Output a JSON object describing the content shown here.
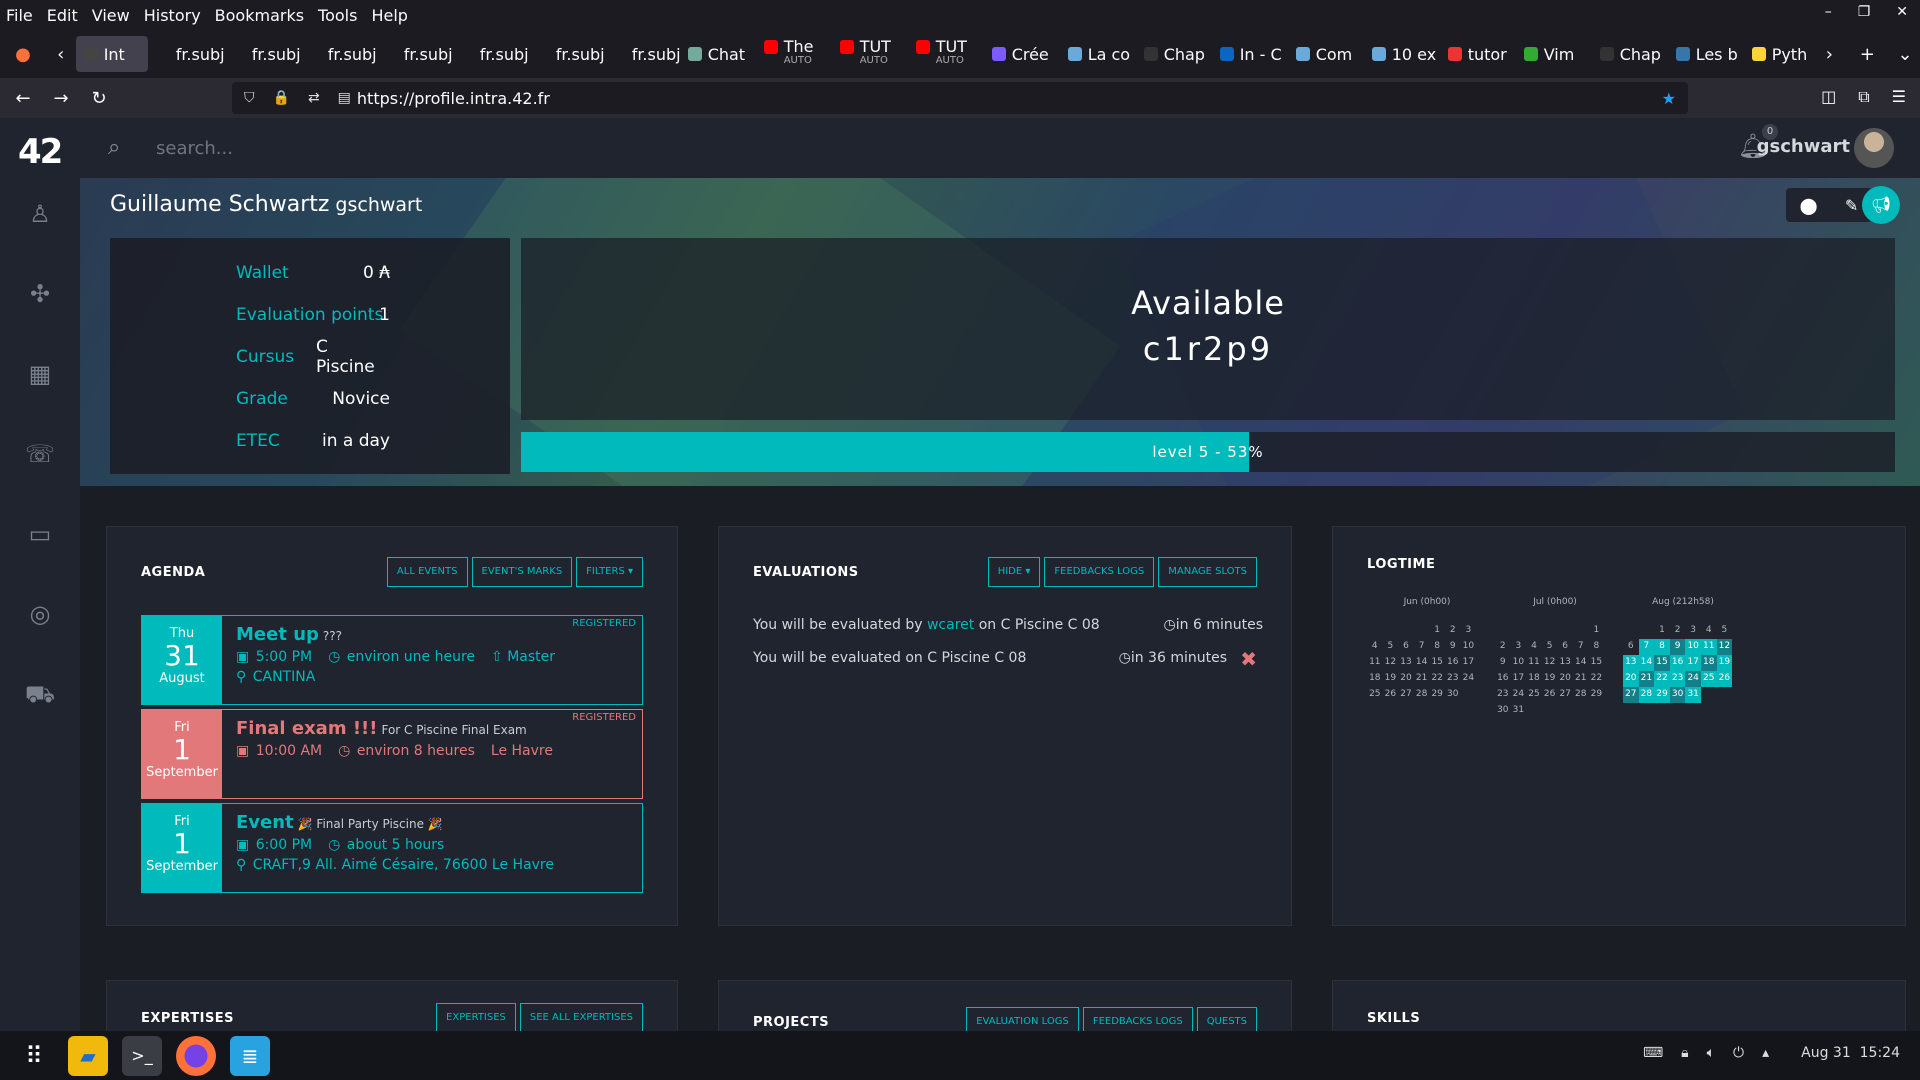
{
  "menubar": [
    "File",
    "Edit",
    "View",
    "History",
    "Bookmarks",
    "Tools",
    "Help"
  ],
  "tabs": [
    {
      "label": "Int",
      "color": "#444"
    },
    {
      "label": "fr.subje",
      "color": ""
    },
    {
      "label": "fr.subje",
      "color": ""
    },
    {
      "label": "fr.subje",
      "color": ""
    },
    {
      "label": "fr.subje",
      "color": ""
    },
    {
      "label": "fr.subje",
      "color": ""
    },
    {
      "label": "fr.subje",
      "color": ""
    },
    {
      "label": "fr.subje",
      "color": ""
    },
    {
      "label": "Chat",
      "color": "#74aa9c"
    },
    {
      "label": "The",
      "sub": "AUTO",
      "color": "#ff0000"
    },
    {
      "label": "TUT",
      "sub": "AUTO",
      "color": "#ff0000"
    },
    {
      "label": "TUT",
      "sub": "AUTO",
      "color": "#ff0000"
    },
    {
      "label": "Crée",
      "color": "#7c5cff"
    },
    {
      "label": "La co",
      "color": "#6aa9d8"
    },
    {
      "label": "Chap",
      "color": "#333"
    },
    {
      "label": "In - C",
      "color": "#0a66c2"
    },
    {
      "label": "Com",
      "color": "#6aa9d8"
    },
    {
      "label": "10 ex",
      "color": "#6aa9d8"
    },
    {
      "label": "tutor",
      "color": "#e33"
    },
    {
      "label": "Vim",
      "color": "#3a3"
    },
    {
      "label": "Chap",
      "color": "#333"
    },
    {
      "label": "Les b",
      "color": "#3776ab"
    },
    {
      "label": "Pyth",
      "color": "#ffd43b"
    }
  ],
  "url": "https://profile.intra.42.fr",
  "brand": "42",
  "search": {
    "placeholder": "search..."
  },
  "notifications": "0",
  "login": "gschwart",
  "profile": {
    "fullname": "Guillaume Schwartz",
    "login": "gschwart",
    "info": [
      {
        "k": "Wallet",
        "v": "0 ₳"
      },
      {
        "k": "Evaluation points",
        "v": "1"
      },
      {
        "k": "Cursus",
        "v": "C Piscine"
      },
      {
        "k": "Grade",
        "v": "Novice"
      },
      {
        "k": "ETEC",
        "v": "in a day"
      }
    ],
    "status": "Available",
    "host": "c1r2p9",
    "level_text": "level 5 - 53%",
    "level_percent": 53
  },
  "agenda": {
    "title": "AGENDA",
    "buttons": [
      "ALL EVENTS",
      "EVENT'S MARKS",
      "FILTERS ▾"
    ],
    "events": [
      {
        "dow": "Thu",
        "day": "31",
        "month": "August",
        "title": "Meet up",
        "sub": "???",
        "time": "5:00 PM",
        "duration": "environ une heure",
        "extra": "⇧ Master",
        "place": "CANTINA",
        "tag": "REGISTERED"
      },
      {
        "dow": "Fri",
        "day": "1",
        "month": "September",
        "title": "Final exam !!!",
        "sub": "For C Piscine Final Exam",
        "time": "10:00 AM",
        "duration": "environ 8 heures",
        "extra": "Le Havre",
        "place": "",
        "tag": "REGISTERED"
      },
      {
        "dow": "Fri",
        "day": "1",
        "month": "September",
        "title": "Event",
        "sub": "🎉 Final Party Piscine 🎉",
        "time": "6:00 PM",
        "duration": "about 5 hours",
        "extra": "",
        "place": "CRAFT,9 All. Aimé Césaire, 76600 Le Havre",
        "tag": ""
      }
    ]
  },
  "evaluations": {
    "title": "EVALUATIONS",
    "buttons": [
      "HIDE ▾",
      "FEEDBACKS LOGS",
      "MANAGE SLOTS"
    ],
    "lines": [
      {
        "pre": "You will be evaluated by ",
        "who": "wcaret",
        "post": " on C Piscine C 08",
        "when": "in 6 minutes"
      },
      {
        "pre": "You will be evaluated on C Piscine C 08",
        "who": "",
        "post": "",
        "when": "in 36 minutes"
      }
    ],
    "cancel": "✖"
  },
  "logtime": {
    "title": "LOGTIME",
    "months": [
      {
        "label": "Jun (0h00)",
        "offset": 4,
        "days": 30,
        "active": []
      },
      {
        "label": "Jul (0h00)",
        "offset": 6,
        "days": 31,
        "active": []
      },
      {
        "label": "Aug (212h58)",
        "offset": 2,
        "days": 31,
        "active": [
          7,
          8,
          9,
          10,
          11,
          12,
          13,
          14,
          15,
          16,
          17,
          18,
          19,
          20,
          21,
          22,
          23,
          24,
          25,
          26,
          27,
          28,
          29,
          30,
          31
        ]
      }
    ]
  },
  "bottom": {
    "expertises": {
      "title": "EXPERTISES",
      "buttons": [
        "EXPERTISES",
        "SEE ALL EXPERTISES"
      ]
    },
    "projects": {
      "title": "PROJECTS",
      "buttons": [
        "EVALUATION LOGS",
        "FEEDBACKS LOGS",
        "QUESTS"
      ]
    },
    "skills": {
      "title": "SKILLS"
    }
  },
  "taskbar": {
    "clock": "Aug 31  15:24"
  }
}
